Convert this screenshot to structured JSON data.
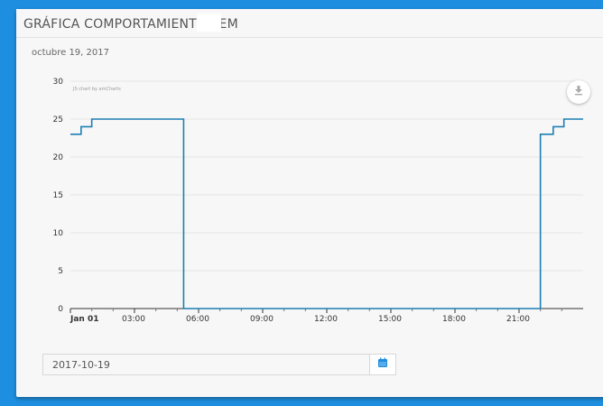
{
  "card": {
    "title": "GRÁFICA COMPORTAMIENTO TEM",
    "date_heading": "octubre 19, 2017"
  },
  "chart": {
    "credit": "JS chart by amCharts",
    "export_icon": "download-icon"
  },
  "date_picker": {
    "value": "2017-10-19",
    "icon": "calendar-icon",
    "accent": "#1e8fe0"
  },
  "chart_data": {
    "type": "line",
    "step": true,
    "line_color": "#1c7fb3",
    "xlim": [
      0,
      24
    ],
    "ylim": [
      0,
      30
    ],
    "y_ticks": [
      0,
      5,
      10,
      15,
      20,
      25,
      30
    ],
    "x_ticks": [
      {
        "x": 0,
        "label": "Jan 01",
        "bold": true
      },
      {
        "x": 3,
        "label": "03:00"
      },
      {
        "x": 6,
        "label": "06:00"
      },
      {
        "x": 9,
        "label": "09:00"
      },
      {
        "x": 12,
        "label": "12:00"
      },
      {
        "x": 15,
        "label": "15:00"
      },
      {
        "x": 18,
        "label": "18:00"
      },
      {
        "x": 21,
        "label": "21:00"
      }
    ],
    "x_unit": "hour",
    "x": [
      -0.1,
      0.5,
      1.0,
      5.3,
      22.0,
      22.6,
      23.1,
      23.6
    ],
    "y": [
      23,
      24,
      25,
      0,
      23,
      24,
      25,
      25
    ],
    "grid": true
  }
}
